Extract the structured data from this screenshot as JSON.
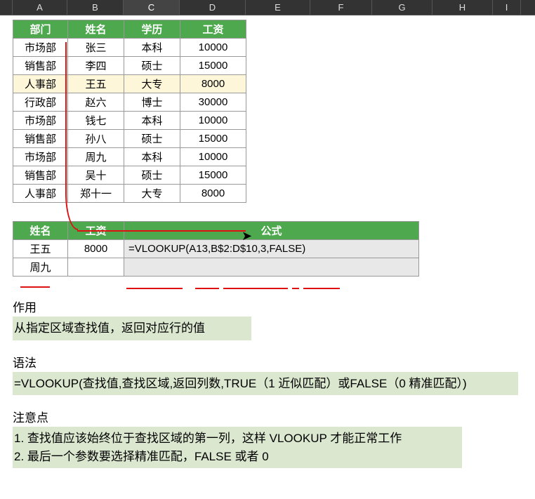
{
  "columns": [
    "A",
    "B",
    "C",
    "D",
    "E",
    "F",
    "G",
    "H",
    "I"
  ],
  "table1": {
    "headers": [
      "部门",
      "姓名",
      "学历",
      "工资"
    ],
    "rows": [
      {
        "dept": "市场部",
        "name": "张三",
        "edu": "本科",
        "salary": "10000"
      },
      {
        "dept": "销售部",
        "name": "李四",
        "edu": "硕士",
        "salary": "15000"
      },
      {
        "dept": "人事部",
        "name": "王五",
        "edu": "大专",
        "salary": "8000",
        "hl": true
      },
      {
        "dept": "行政部",
        "name": "赵六",
        "edu": "博士",
        "salary": "30000"
      },
      {
        "dept": "市场部",
        "name": "钱七",
        "edu": "本科",
        "salary": "10000"
      },
      {
        "dept": "销售部",
        "name": "孙八",
        "edu": "硕士",
        "salary": "15000"
      },
      {
        "dept": "市场部",
        "name": "周九",
        "edu": "本科",
        "salary": "10000"
      },
      {
        "dept": "销售部",
        "name": "吴十",
        "edu": "硕士",
        "salary": "15000"
      },
      {
        "dept": "人事部",
        "name": "郑十一",
        "edu": "大专",
        "salary": "8000"
      }
    ]
  },
  "table2": {
    "headers": [
      "姓名",
      "工资",
      "公式"
    ],
    "rows": [
      {
        "name": "王五",
        "salary": "8000",
        "formula": "=VLOOKUP(A13,B$2:D$10,3,FALSE)"
      },
      {
        "name": "周九",
        "salary": "",
        "formula": ""
      }
    ]
  },
  "notes": {
    "purpose_title": "作用",
    "purpose_body": "从指定区域查找值，返回对应行的值",
    "syntax_title": "语法",
    "syntax_body": "=VLOOKUP(查找值,查找区域,返回列数,TRUE（1 近似匹配）或FALSE（0 精准匹配）)",
    "tips_title": "注意点",
    "tips_1": "1. 查找值应该始终位于查找区域的第一列，这样 VLOOKUP 才能正常工作",
    "tips_2": "2. 最后一个参数要选择精准匹配，FALSE 或者 0"
  }
}
